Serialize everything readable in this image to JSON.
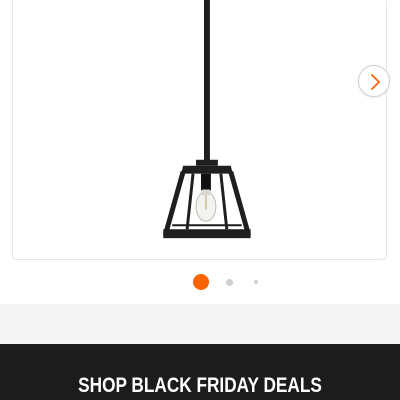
{
  "product": {
    "image_icon": "pendant-light-image"
  },
  "carousel": {
    "next_icon": "chevron-right-icon",
    "dot_count": 3,
    "active_index": 0,
    "active_color": "#f96302",
    "inactive_color": "#cfcfcf"
  },
  "promo": {
    "label": "SHOP BLACK FRIDAY DEALS",
    "background": "#1c1c1c",
    "text_color": "#ffffff"
  }
}
